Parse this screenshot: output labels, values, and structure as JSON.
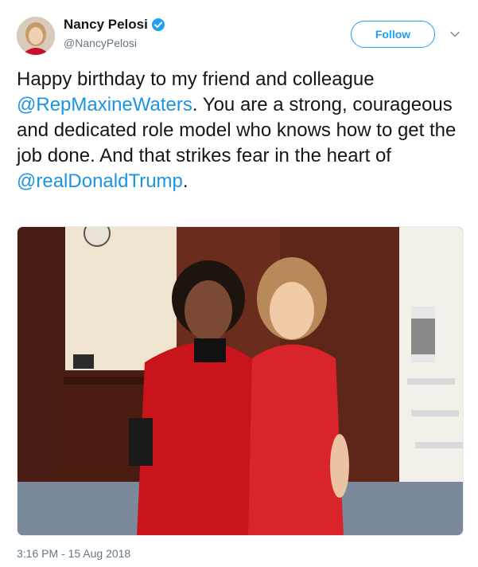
{
  "header": {
    "display_name": "Nancy Pelosi",
    "handle": "@NancyPelosi",
    "verified_icon": "verified-badge-icon",
    "follow_label": "Follow",
    "more_icon": "chevron-down-icon",
    "accent_color": "#1da1f2"
  },
  "tweet": {
    "segments": {
      "s1": "Happy birthday to my friend and colleague ",
      "m1": "@RepMaxineWaters",
      "s2": ". You are a strong, courageous and dedicated role model who knows how to get the job done. And that strikes fear in the heart of ",
      "m2": "@realDonaldTrump",
      "s3": "."
    },
    "mention_color": "#1b95e0"
  },
  "media": {
    "icon": "photo-icon"
  },
  "footer": {
    "timestamp": "3:16 PM - 15 Aug 2018"
  }
}
